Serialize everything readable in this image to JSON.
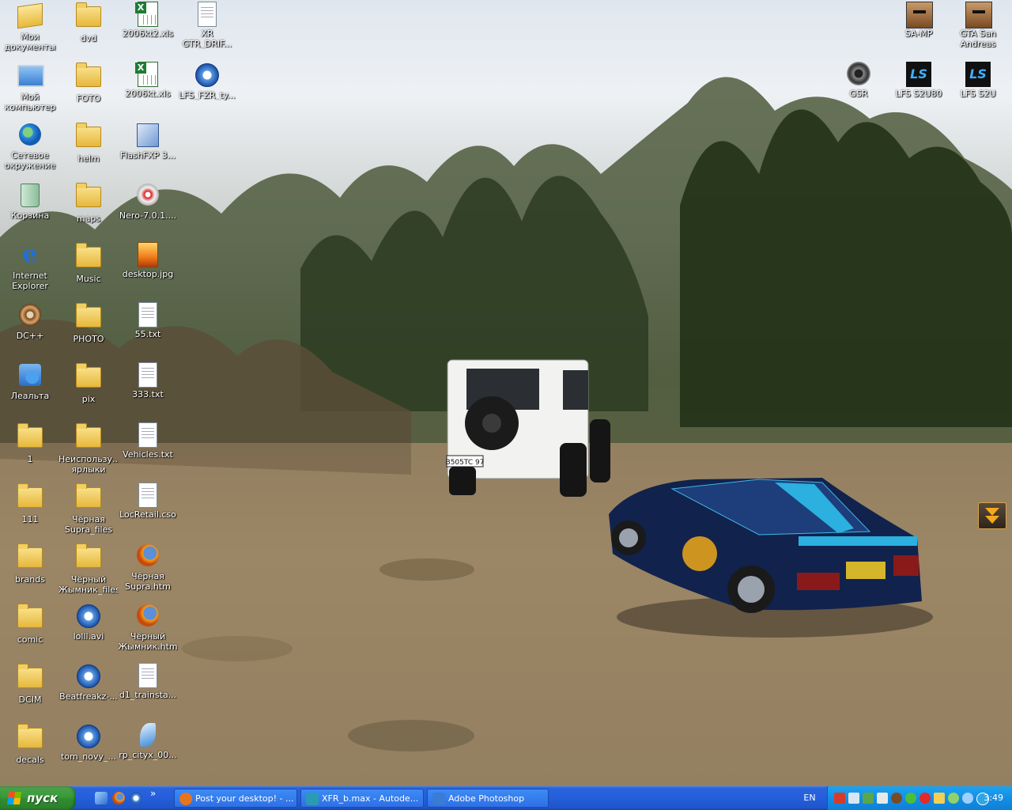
{
  "desktop": {
    "icons_left": [
      {
        "label": "Мои документы",
        "icon": "my-documents-icon",
        "type": "mydocs"
      },
      {
        "label": "dvd",
        "icon": "folder-icon",
        "type": "folder"
      },
      {
        "label": "2006kt2.xls",
        "icon": "excel-file-icon",
        "type": "xls"
      },
      {
        "label": "XR GTR_DRIF...",
        "icon": "document-file-icon",
        "type": "doc"
      },
      {
        "label": "Мой компьютер",
        "icon": "my-computer-icon",
        "type": "pc"
      },
      {
        "label": "FOTO",
        "icon": "folder-icon",
        "type": "folder"
      },
      {
        "label": "2006kt.xls",
        "icon": "excel-file-icon",
        "type": "xls"
      },
      {
        "label": "LFS_FZR_ty...",
        "icon": "media-file-icon",
        "type": "media"
      },
      {
        "label": "Сетевое окружение",
        "icon": "network-icon",
        "type": "net"
      },
      {
        "label": "helm",
        "icon": "folder-icon",
        "type": "folder"
      },
      {
        "label": "FlashFXP 3...",
        "icon": "flashfxp-icon",
        "type": "flash"
      },
      {
        "label": "Корзина",
        "icon": "recycle-bin-icon",
        "type": "bin"
      },
      {
        "label": "maps",
        "icon": "folder-icon",
        "type": "folder"
      },
      {
        "label": "Nero-7.0.1....",
        "icon": "nero-icon",
        "type": "nero"
      },
      {
        "label": "Internet Explorer",
        "icon": "internet-explorer-icon",
        "type": "ie"
      },
      {
        "label": "Music",
        "icon": "folder-icon",
        "type": "folder"
      },
      {
        "label": "desktop.jpg",
        "icon": "image-file-icon",
        "type": "jpg"
      },
      {
        "label": "DC++",
        "icon": "dcpp-icon",
        "type": "dc"
      },
      {
        "label": "PHOTO",
        "icon": "folder-icon",
        "type": "folder"
      },
      {
        "label": "55.txt",
        "icon": "text-file-icon",
        "type": "doc"
      },
      {
        "label": "Леальта",
        "icon": "lealta-icon",
        "type": "leal"
      },
      {
        "label": "pix",
        "icon": "folder-icon",
        "type": "folder"
      },
      {
        "label": "333.txt",
        "icon": "text-file-icon",
        "type": "doc"
      },
      {
        "label": "1",
        "icon": "folder-icon",
        "type": "folder"
      },
      {
        "label": "Неиспользу... ярлыки",
        "icon": "folder-icon",
        "type": "folder"
      },
      {
        "label": "Vehicles.txt",
        "icon": "text-file-icon",
        "type": "doc"
      },
      {
        "label": "111",
        "icon": "folder-icon",
        "type": "folder"
      },
      {
        "label": "Чёрная Supra_files",
        "icon": "folder-icon",
        "type": "folder"
      },
      {
        "label": "LocRetail.cso",
        "icon": "document-file-icon",
        "type": "doc"
      },
      {
        "label": "brands",
        "icon": "folder-icon",
        "type": "folder"
      },
      {
        "label": "Чёрный Жымник_files",
        "icon": "folder-icon",
        "type": "folder"
      },
      {
        "label": "Чёрная Supra.htm",
        "icon": "firefox-html-icon",
        "type": "ff"
      },
      {
        "label": "comic",
        "icon": "folder-icon",
        "type": "folder"
      },
      {
        "label": "lolll.avi",
        "icon": "media-file-icon",
        "type": "media"
      },
      {
        "label": "Чёрный Жымник.htm",
        "icon": "firefox-html-icon",
        "type": "ff"
      },
      {
        "label": "DCIM",
        "icon": "folder-icon",
        "type": "folder"
      },
      {
        "label": "Beatfreakz-...",
        "icon": "media-file-icon",
        "type": "media"
      },
      {
        "label": "d1_trainsta...",
        "icon": "document-file-icon",
        "type": "doc"
      },
      {
        "label": "decals",
        "icon": "folder-icon",
        "type": "folder"
      },
      {
        "label": "tom_novy_...",
        "icon": "media-file-icon",
        "type": "media"
      },
      {
        "label": "rp_cityx_00...",
        "icon": "feather-file-icon",
        "type": "feather"
      }
    ],
    "icons_right": [
      {
        "label": "SA-MP",
        "icon": "samp-icon",
        "type": "avatar"
      },
      {
        "label": "GTA San Andreas",
        "icon": "gta-san-andreas-icon",
        "type": "avatar"
      },
      {
        "label": "GSR",
        "icon": "gsr-icon",
        "type": "gsr"
      },
      {
        "label": "LFS S2U80",
        "icon": "lfs-icon",
        "type": "lfs"
      },
      {
        "label": "LFS S2U",
        "icon": "lfs-icon",
        "type": "lfs"
      }
    ],
    "license_plate": "B505TC 97"
  },
  "taskbar": {
    "start_label": "пуск",
    "quick_launch_icons": [
      "show-desktop-icon",
      "firefox-icon",
      "browser-icon"
    ],
    "overflow": "»",
    "tasks": [
      {
        "label": "Post your desktop! - ...",
        "icon": "firefox-icon",
        "color": "#e8741c"
      },
      {
        "label": "XFR_b.max - Autode...",
        "icon": "3dsmax-icon",
        "color": "#2b9bb5"
      },
      {
        "label": "Adobe Photoshop",
        "icon": "photoshop-icon",
        "color": "#3a7bd5"
      }
    ],
    "language": "EN",
    "tray_icons": [
      "antivirus-icon",
      "network-tray-icon",
      "bluetooth-icon",
      "volume-icon",
      "dc-tray-icon",
      "flower-icon",
      "flash-tray-icon",
      "folder-tray-icon",
      "messenger-icon",
      "search-tray-icon",
      "skype-icon"
    ],
    "clock": "3:49"
  }
}
